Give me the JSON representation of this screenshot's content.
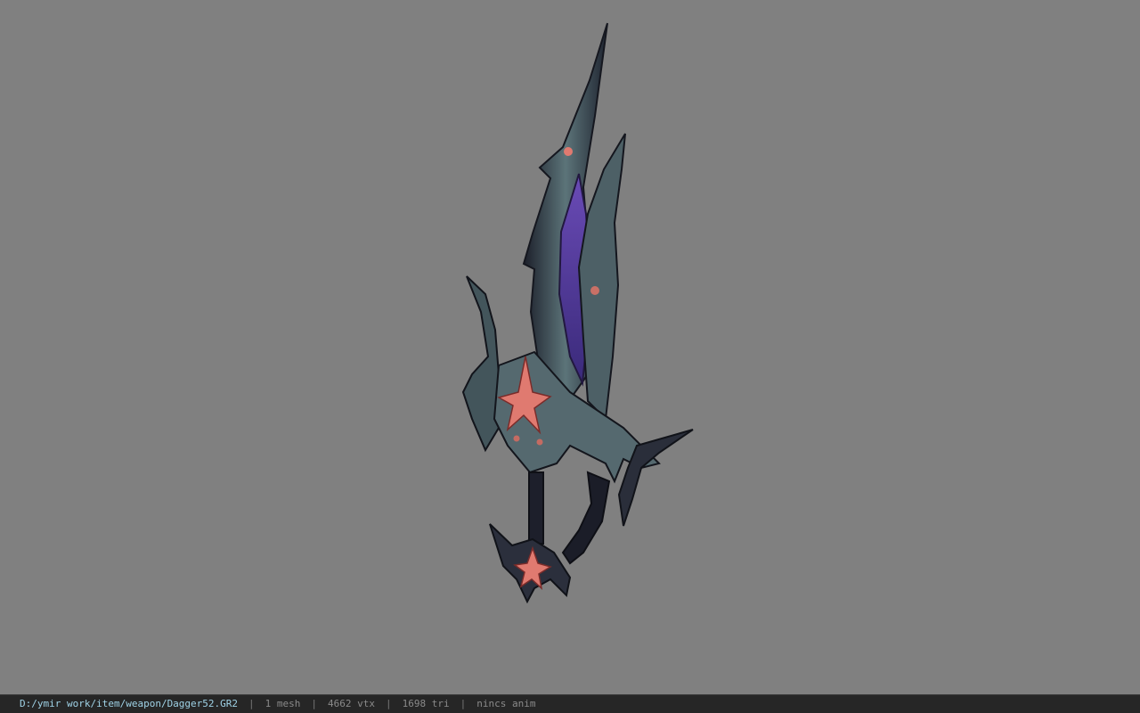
{
  "viewer": {
    "background_color": "#808080",
    "model_icon": "dagger-model"
  },
  "status": {
    "file_path": "D:/ymir work/item/weapon/Dagger52.GR2",
    "separator": "|",
    "mesh_count": "1 mesh",
    "vertex_count": "4662 vtx",
    "triangle_count": "1698 tri",
    "anim_status": "nincs anim"
  }
}
